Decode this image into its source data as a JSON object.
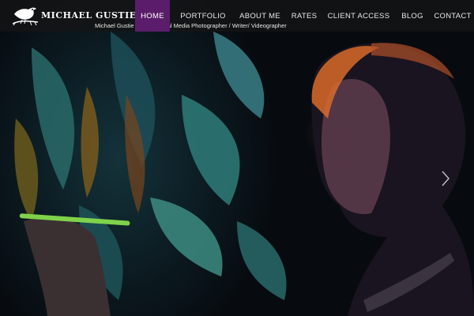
{
  "site": {
    "logo_text": "MICHAEL GUSTIE",
    "tagline": "Michael Gustie - Professional Media Photographer / Writer/ Videographer"
  },
  "nav": {
    "home": "HOME",
    "portfolio": "PORTFOLIO",
    "about": "ABOUT ME",
    "rates": "RATES",
    "client_access": "CLIENT ACCESS",
    "blog": "BLOG",
    "contact": "CONTACT",
    "active": "HOME"
  },
  "colors": {
    "nav_active_bg": "#5b1d6b",
    "nav_bar_bg": "#141414"
  },
  "icons": {
    "logo": "bird-on-branch-icon",
    "slider_next": "chevron-right-icon"
  }
}
